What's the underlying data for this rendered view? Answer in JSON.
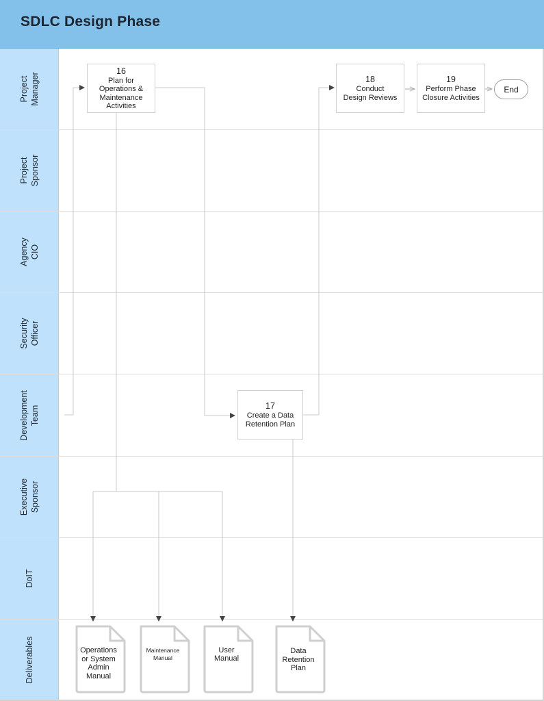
{
  "header": {
    "title": "SDLC Design Phase"
  },
  "colors": {
    "header_bg": "#84c1ea",
    "lane_label_bg": "#bfe1fb",
    "line": "#c8c8c8",
    "arrow": "#444444"
  },
  "lanes": [
    {
      "label": "Project\nManager"
    },
    {
      "label": "Project\nSponsor"
    },
    {
      "label": "Agency\nCIO"
    },
    {
      "label": "Security\nOfficer"
    },
    {
      "label": "Development\nTeam"
    },
    {
      "label": "Executive\nSponsor"
    },
    {
      "label": "DoIT"
    },
    {
      "label": "Deliverables"
    }
  ],
  "steps": {
    "s16": {
      "number": "16",
      "label": "Plan for\nOperations &\nMaintenance\nActivities",
      "lane": "Project Manager"
    },
    "s17": {
      "number": "17",
      "label": "Create a Data\nRetention Plan",
      "lane": "Development Team"
    },
    "s18": {
      "number": "18",
      "label": "Conduct\nDesign Reviews",
      "lane": "Project Manager"
    },
    "s19": {
      "number": "19",
      "label": "Perform Phase\nClosure Activities",
      "lane": "Project Manager"
    },
    "end": {
      "label": "End"
    }
  },
  "deliverables": [
    {
      "label": "Operations\nor System\nAdmin\nManual"
    },
    {
      "label": "Maintenance\nManual"
    },
    {
      "label": "User\nManual"
    },
    {
      "label": "Data\nRetention\nPlan"
    }
  ],
  "flows": [
    {
      "from": "Development Team (entry)",
      "to": "16"
    },
    {
      "from": "16",
      "to": "17"
    },
    {
      "from": "17",
      "to": "18"
    },
    {
      "from": "18",
      "to": "19"
    },
    {
      "from": "19",
      "to": "End"
    },
    {
      "from": "16",
      "to": "Operations or System Admin Manual"
    },
    {
      "from": "16",
      "to": "Maintenance Manual"
    },
    {
      "from": "16",
      "to": "User Manual"
    },
    {
      "from": "17",
      "to": "Data Retention Plan"
    }
  ]
}
